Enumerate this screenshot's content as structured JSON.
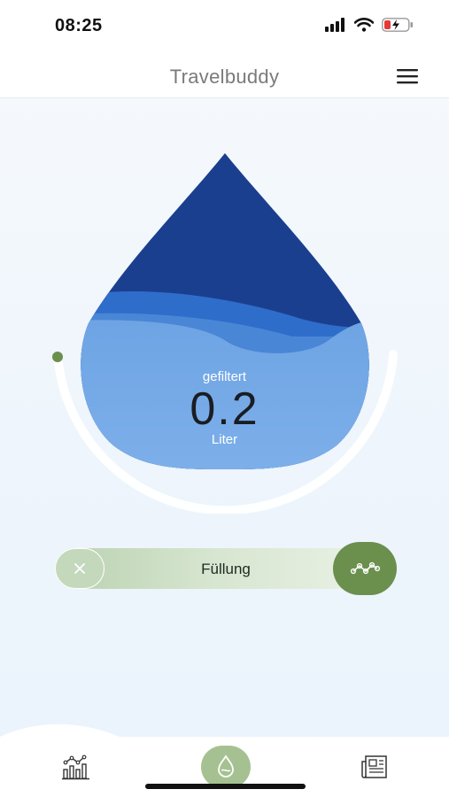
{
  "status_bar": {
    "time": "08:25",
    "icons": [
      "signal-icon",
      "wifi-icon",
      "battery-charging-icon"
    ]
  },
  "header": {
    "title": "Travelbuddy",
    "menu_icon": "hamburger-menu-icon"
  },
  "gauge": {
    "label": "gefiltert",
    "value": "0.2",
    "unit": "Liter"
  },
  "slider": {
    "label": "Füllung",
    "close_icon": "close-icon",
    "handle_icon": "trend-icon"
  },
  "bottom_nav": {
    "items": [
      {
        "icon": "statistics-icon",
        "active": false
      },
      {
        "icon": "water-drop-icon",
        "active": true
      },
      {
        "icon": "news-icon",
        "active": false
      }
    ]
  },
  "colors": {
    "drop_dark": "#1b3f8f",
    "drop_mid": "#2e6cc9",
    "drop_light": "#72a8e6",
    "accent_green": "#6b8f4d",
    "nav_active": "#a6c191"
  }
}
